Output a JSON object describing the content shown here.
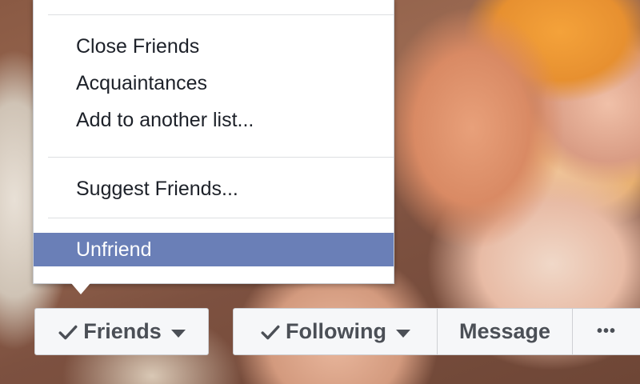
{
  "menu": {
    "items": [
      {
        "label": "Close Friends"
      },
      {
        "label": "Acquaintances"
      },
      {
        "label": "Add to another list..."
      },
      {
        "label": "Suggest Friends..."
      },
      {
        "label": "Unfriend",
        "highlighted": true
      }
    ],
    "highlight_color": "#6a7fb7"
  },
  "buttons": {
    "friends": {
      "label": "Friends",
      "icon": "check-icon",
      "dropdown": "caret-down-icon"
    },
    "following": {
      "label": "Following",
      "icon": "check-icon",
      "dropdown": "caret-down-icon"
    },
    "message": {
      "label": "Message"
    },
    "more": {
      "label": "•••"
    }
  },
  "colors": {
    "button_bg": "#f6f7f9",
    "button_text": "#4b4f56",
    "button_border": "#ced0d4"
  }
}
